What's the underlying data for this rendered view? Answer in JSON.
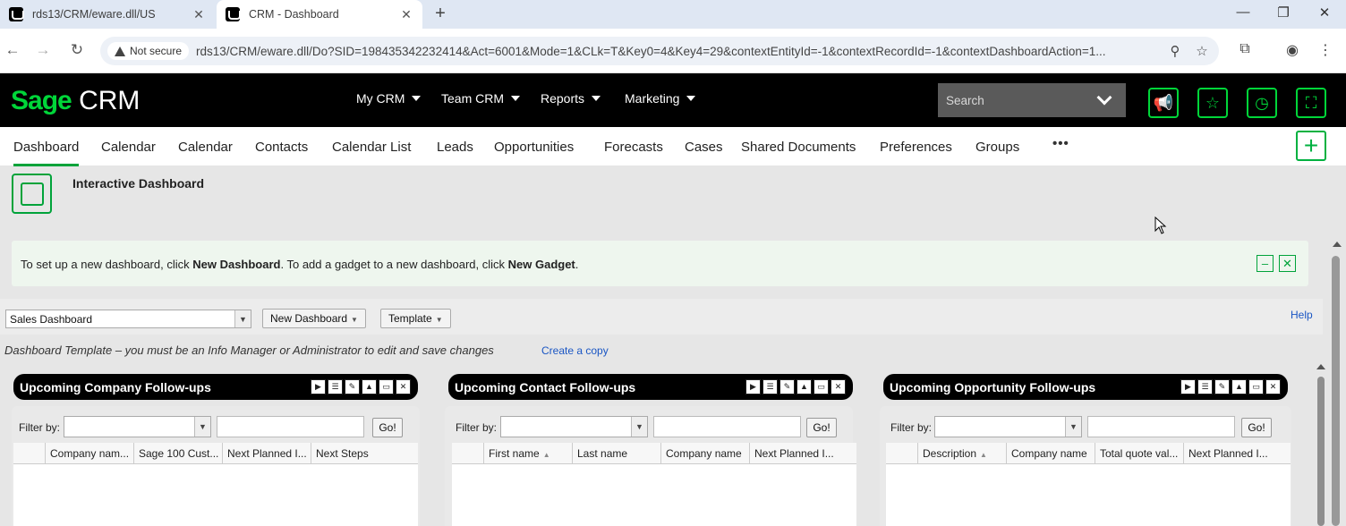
{
  "browser": {
    "tabs": [
      {
        "title": "rds13/CRM/eware.dll/US",
        "active": false
      },
      {
        "title": "CRM - Dashboard",
        "active": true
      }
    ],
    "not_secure": "Not secure",
    "url": "rds13/CRM/eware.dll/Do?SID=198435342232414&Act=6001&Mode=1&CLk=T&Key0=4&Key4=29&contextEntityId=-1&contextRecordId=-1&contextDashboardAction=1..."
  },
  "header": {
    "logo_sage": "Sage",
    "logo_crm": "CRM",
    "menus": [
      "My CRM",
      "Team CRM",
      "Reports",
      "Marketing"
    ],
    "search_placeholder": "Search"
  },
  "nav": {
    "tabs": [
      "Dashboard",
      "Calendar",
      "Calendar",
      "Contacts",
      "Calendar List",
      "Leads",
      "Opportunities",
      "Forecasts",
      "Cases",
      "Shared Documents",
      "Preferences",
      "Groups"
    ],
    "more": "•••"
  },
  "page": {
    "title": "Interactive Dashboard",
    "banner": {
      "t1": "To set up a new dashboard, click ",
      "b1": "New Dashboard",
      "t2": ". To add a gadget to a new dashboard, click ",
      "b2": "New Gadget",
      "t3": "."
    },
    "dashboard_select": "Sales Dashboard",
    "new_dashboard": "New Dashboard",
    "template": "Template",
    "help": "Help",
    "template_note": "Dashboard Template – you must be an Info Manager or Administrator to edit and save changes",
    "create_copy": "Create a copy"
  },
  "gadgets": [
    {
      "title": "Upcoming Company Follow-ups",
      "filter_label": "Filter by:",
      "go": "Go!",
      "columns": [
        "Company nam...",
        "Sage 100 Cust...",
        "Next Planned I...",
        "Next Steps"
      ],
      "sorted": -1
    },
    {
      "title": "Upcoming Contact Follow-ups",
      "filter_label": "Filter by:",
      "go": "Go!",
      "columns": [
        "First name",
        "Last name",
        "Company name",
        "Next Planned I..."
      ],
      "sorted": 0
    },
    {
      "title": "Upcoming Opportunity Follow-ups",
      "filter_label": "Filter by:",
      "go": "Go!",
      "columns": [
        "Description",
        "Company name",
        "Total quote val...",
        "Next Planned I..."
      ],
      "sorted": 0
    }
  ],
  "colors": {
    "brand_green": "#00d639",
    "accent_green": "#00a33a",
    "link_blue": "#1a56c4"
  }
}
